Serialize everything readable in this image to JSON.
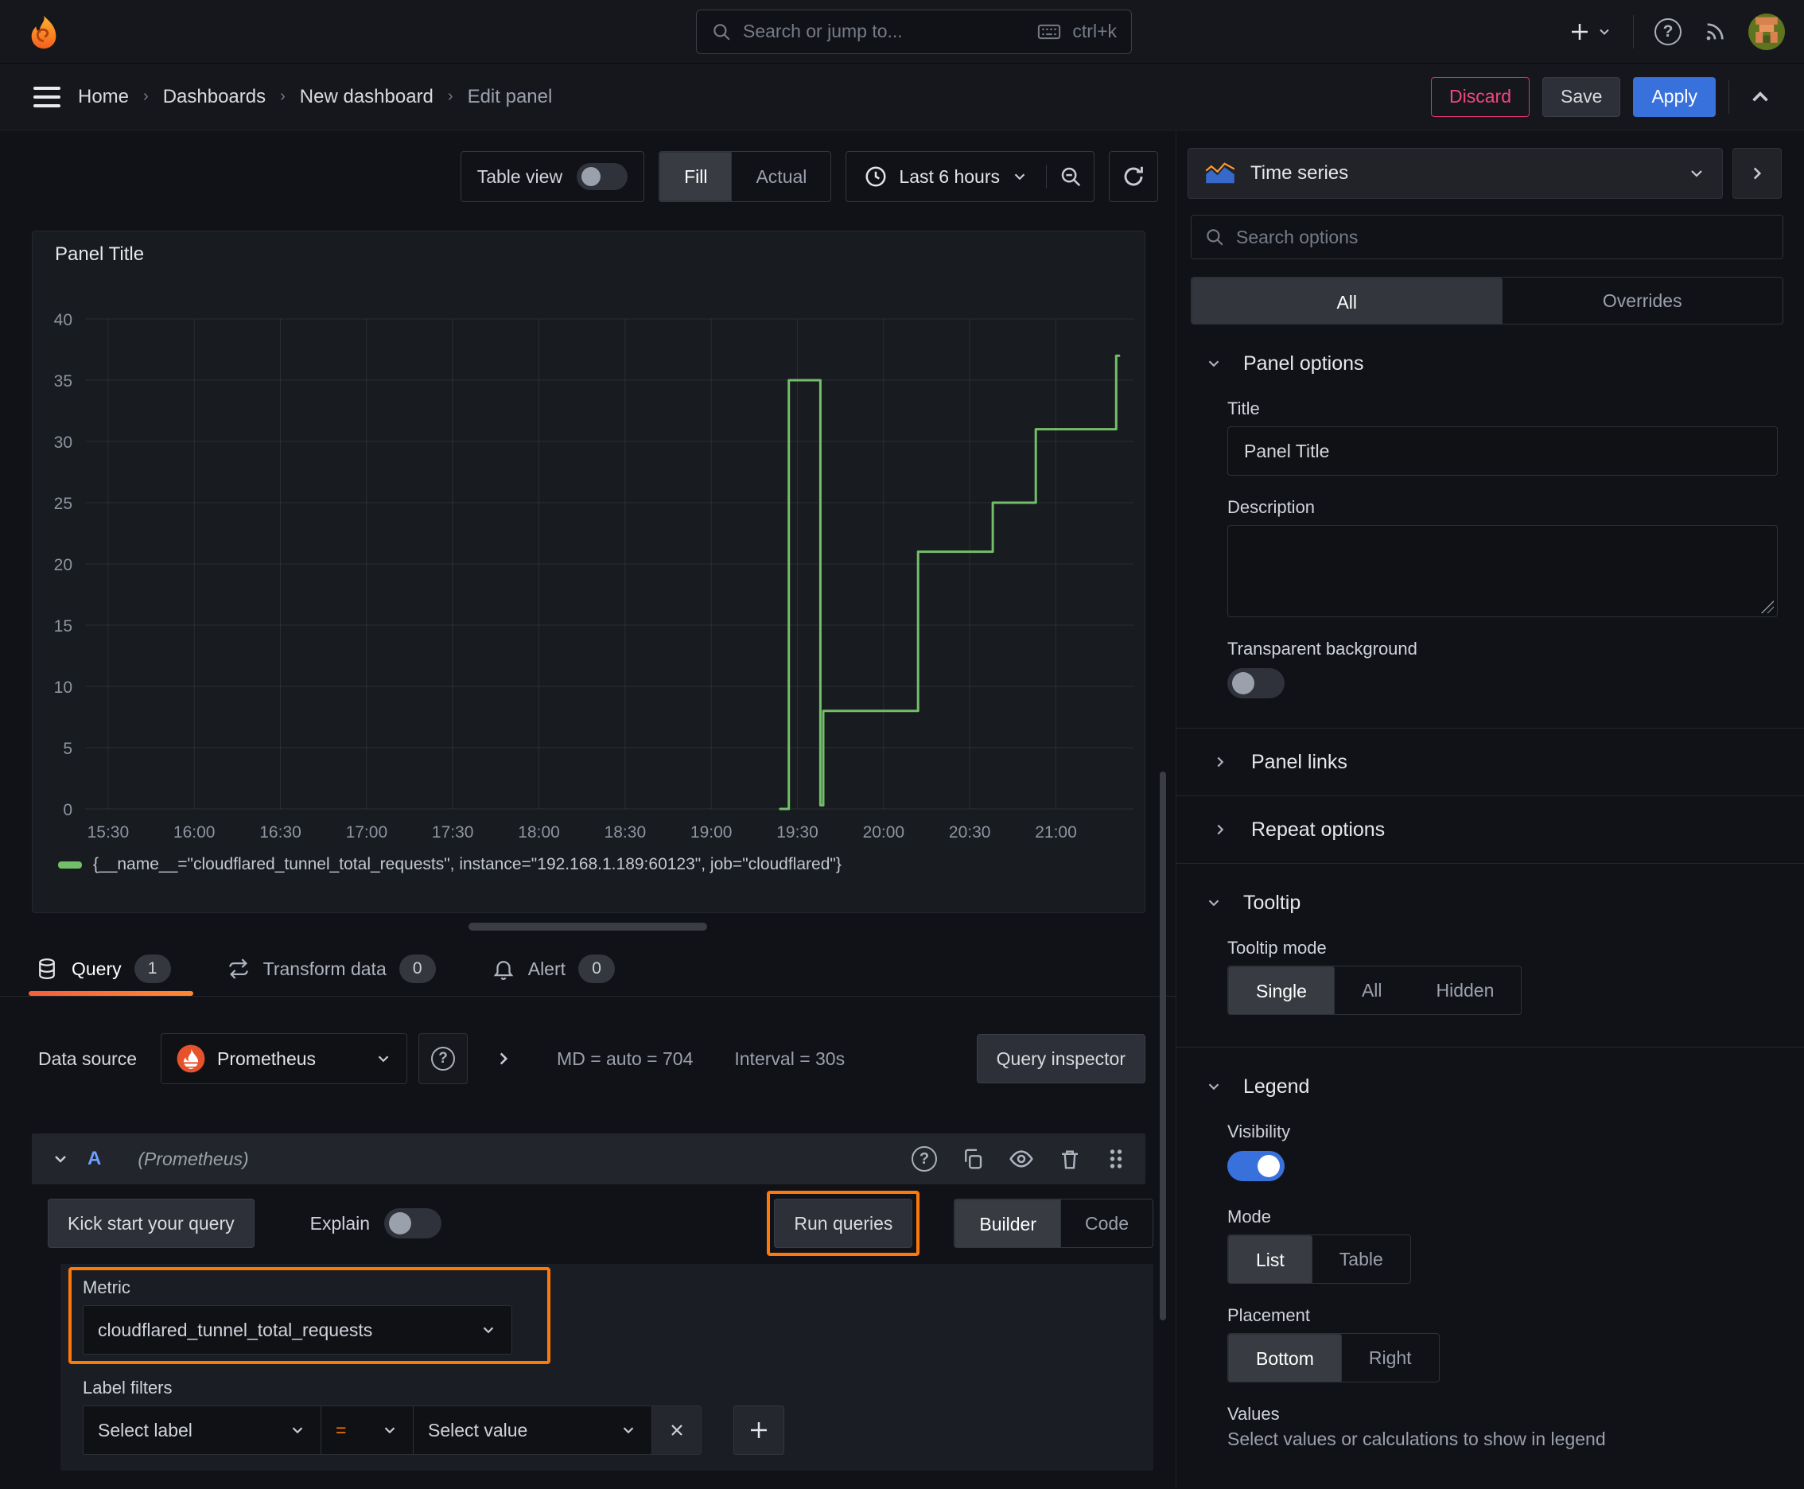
{
  "colors": {
    "accent_blue": "#3871DC",
    "annotation_orange": "#FF780A",
    "danger_pink": "#E0316B",
    "series_green": "#73BF69",
    "tab_underline_gradient": [
      "#F55F3E",
      "#FF8833"
    ],
    "panel_bg": "#181B1F",
    "page_bg": "#111217"
  },
  "icons": {
    "grafana-logo": "orange flame spiral",
    "search": "magnifier",
    "keyboard": "keyboard outline",
    "add": "plus with chevron",
    "help": "question mark circle",
    "news": "rss arcs",
    "avatar": "pixel avatar",
    "menu": "hamburger",
    "clock": "clock face",
    "zoom-out": "magnifier minus",
    "refresh": "circular arrow",
    "timeseries": "blue area with orange line",
    "database": "cylinder stack",
    "transform": "swap arrows",
    "alert": "bell",
    "copy": "two sheets",
    "eye": "eye",
    "trash": "trash can",
    "grip": "six dots"
  },
  "topnav": {
    "search_placeholder": "Search or jump to...",
    "search_shortcut": "ctrl+k"
  },
  "breadcrumb": {
    "items": [
      "Home",
      "Dashboards",
      "New dashboard",
      "Edit panel"
    ],
    "separator": "›"
  },
  "actions": {
    "discard": "Discard",
    "save": "Save",
    "apply": "Apply"
  },
  "toolbar": {
    "table_view": "Table view",
    "fill": "Fill",
    "actual": "Actual",
    "time_range": "Last 6 hours"
  },
  "panel": {
    "title": "Panel Title"
  },
  "chart_data": {
    "type": "line",
    "line_style": "step",
    "title": "Panel Title",
    "grid": true,
    "legend_position": "bottom",
    "x_axis": {
      "unit": "minutes after 15:00",
      "min_minute": 22,
      "max_minute": 387,
      "ticks": [
        {
          "m": 30,
          "label": "15:30"
        },
        {
          "m": 60,
          "label": "16:00"
        },
        {
          "m": 90,
          "label": "16:30"
        },
        {
          "m": 120,
          "label": "17:00"
        },
        {
          "m": 150,
          "label": "17:30"
        },
        {
          "m": 180,
          "label": "18:00"
        },
        {
          "m": 210,
          "label": "18:30"
        },
        {
          "m": 240,
          "label": "19:00"
        },
        {
          "m": 270,
          "label": "19:30"
        },
        {
          "m": 300,
          "label": "20:00"
        },
        {
          "m": 330,
          "label": "20:30"
        },
        {
          "m": 360,
          "label": "21:00"
        }
      ]
    },
    "y_axis": {
      "min": 0,
      "max": 40,
      "ticks": [
        0,
        5,
        10,
        15,
        20,
        25,
        30,
        35,
        40
      ]
    },
    "series": [
      {
        "name": "{__name__=\"cloudflared_tunnel_total_requests\", instance=\"192.168.1.189:60123\", job=\"cloudflared\"}",
        "color": "#73BF69",
        "points_minute_value": [
          [
            264,
            0
          ],
          [
            267,
            0
          ],
          [
            267,
            35
          ],
          [
            278,
            35
          ],
          [
            278,
            0.3
          ],
          [
            279,
            0.3
          ],
          [
            279,
            8
          ],
          [
            312,
            8
          ],
          [
            312,
            21
          ],
          [
            338,
            21
          ],
          [
            338,
            25
          ],
          [
            353,
            25
          ],
          [
            353,
            31
          ],
          [
            381,
            31
          ],
          [
            381,
            37
          ],
          [
            382,
            37
          ]
        ]
      }
    ]
  },
  "query_section": {
    "tabs": [
      {
        "label": "Query",
        "count": "1"
      },
      {
        "label": "Transform data",
        "count": "0"
      },
      {
        "label": "Alert",
        "count": "0"
      }
    ],
    "datasource_label": "Data source",
    "datasource": "Prometheus",
    "stats": {
      "md": "MD = auto = 704",
      "interval": "Interval = 30s"
    },
    "inspector": "Query inspector",
    "row": {
      "ref": "A",
      "ds_hint": "(Prometheus)"
    },
    "kickstart": "Kick start your query",
    "explain": "Explain",
    "run": "Run queries",
    "builder": "Builder",
    "code": "Code",
    "metric_label": "Metric",
    "metric_value": "cloudflared_tunnel_total_requests",
    "label_filters": "Label filters",
    "select_label": "Select label",
    "equals": "=",
    "select_value": "Select value",
    "remove": "x",
    "add": "+"
  },
  "sidebar": {
    "viz_type": "Time series",
    "search_placeholder": "Search options",
    "tabs": {
      "all": "All",
      "overrides": "Overrides"
    },
    "panel_options": {
      "header": "Panel options",
      "title_label": "Title",
      "title_value": "Panel Title",
      "description_label": "Description",
      "transparent_label": "Transparent background",
      "panel_links": "Panel links",
      "repeat_options": "Repeat options"
    },
    "tooltip": {
      "header": "Tooltip",
      "mode_label": "Tooltip mode",
      "modes": [
        "Single",
        "All",
        "Hidden"
      ],
      "selected_mode": "Single"
    },
    "legend": {
      "header": "Legend",
      "visibility_label": "Visibility",
      "mode_label": "Mode",
      "modes": [
        "List",
        "Table"
      ],
      "selected_mode": "List",
      "placement_label": "Placement",
      "placements": [
        "Bottom",
        "Right"
      ],
      "selected_placement": "Bottom",
      "values_label": "Values",
      "values_desc": "Select values or calculations to show in legend"
    }
  }
}
